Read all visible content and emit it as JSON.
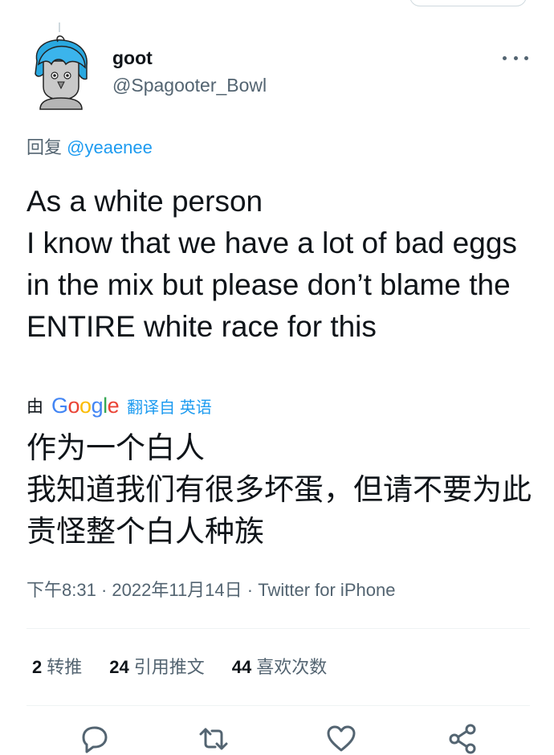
{
  "author": {
    "name": "goot",
    "handle": "@Spagooter_Bowl"
  },
  "reply": {
    "prefix": "回复",
    "handle": "@yeaenee"
  },
  "tweet": {
    "text": "As a white person\nI know that we have a lot of bad eggs in the mix but please don’t blame the ENTIRE white race for this"
  },
  "translation": {
    "by": "由",
    "provider": "Google",
    "from": "翻译自 英语",
    "text": "作为一个白人\n我知道我们有很多坏蛋，但请不要为此责怪整个白人种族"
  },
  "meta": {
    "time": "下午8:31",
    "date": "2022年11月14日",
    "source": "Twitter for iPhone"
  },
  "stats": {
    "retweets_count": "2",
    "retweets_label": "转推",
    "quotes_count": "24",
    "quotes_label": "引用推文",
    "likes_count": "44",
    "likes_label": "喜欢次数"
  },
  "icons": {
    "more": "more-horizontal-icon",
    "reply": "reply-icon",
    "retweet": "retweet-icon",
    "like": "heart-icon",
    "share": "share-icon"
  },
  "colors": {
    "accent": "#1d9bf0",
    "secondary_text": "#536471",
    "primary_text": "#0f1419"
  }
}
